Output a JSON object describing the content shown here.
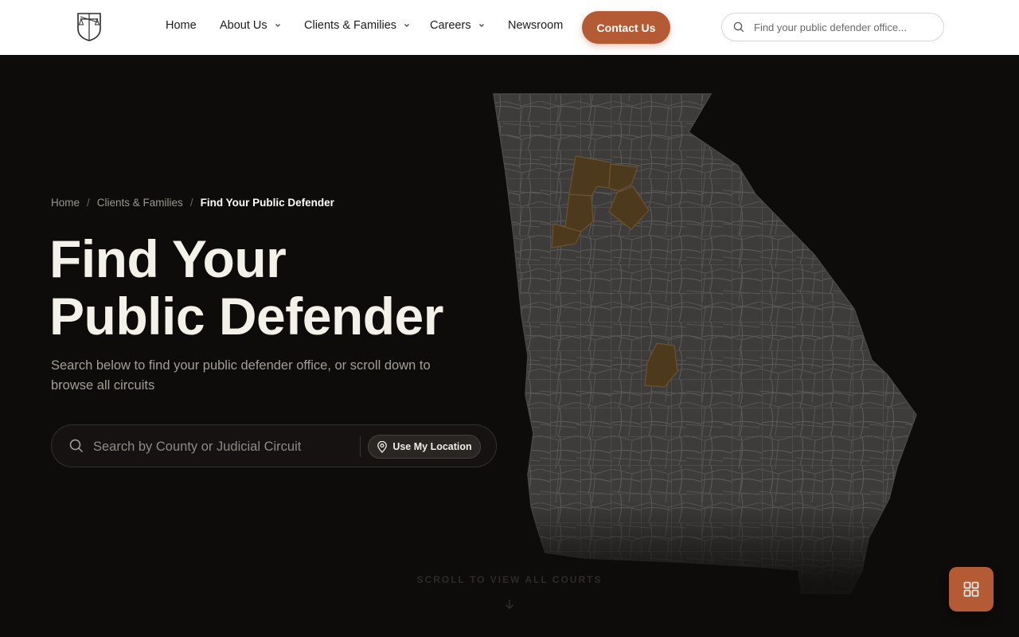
{
  "header": {
    "nav": [
      {
        "label": "Home",
        "has_dropdown": false
      },
      {
        "label": "About Us",
        "has_dropdown": true
      },
      {
        "label": "Clients & Families",
        "has_dropdown": true
      },
      {
        "label": "Careers",
        "has_dropdown": true
      },
      {
        "label": "Newsroom",
        "has_dropdown": false
      }
    ],
    "contact_label": "Contact Us",
    "search_placeholder": "Find your public defender office..."
  },
  "hero": {
    "breadcrumb": [
      "Home",
      "Clients & Families",
      "Find Your Public Defender"
    ],
    "title_line1": "Find Your",
    "title_line2": "Public Defender",
    "subtitle": "Search below to find your public defender office, or scroll down to browse all circuits",
    "search_placeholder": "Search by County or Judicial Circuit",
    "location_label": "Use My Location",
    "scroll_label": "SCROLL TO VIEW ALL COURTS"
  },
  "map": {
    "region": "Georgia counties",
    "highlighted_counties": 6
  },
  "colors": {
    "accent": "#b45a35",
    "hero_bg": "#0e0c0b",
    "county_fill": "#3d3c3b",
    "county_stroke": "#5c5a58",
    "highlight_fill": "#4d3a1c"
  },
  "icons": {
    "header_search": "search-icon",
    "hero_search": "search-icon",
    "location": "map-pin-icon",
    "fab": "grid-icon",
    "dropdown": "chevron-down-icon"
  }
}
